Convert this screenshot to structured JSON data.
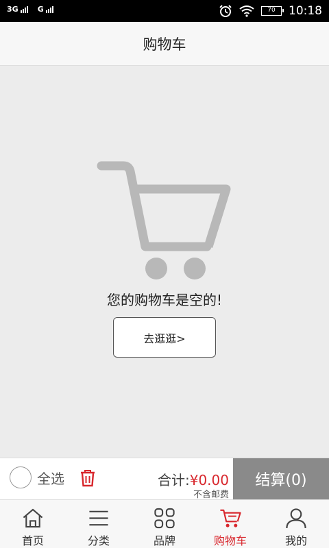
{
  "status_bar": {
    "sim1_label": "3G",
    "sim2_label": "G",
    "battery_level": "70",
    "time": "10:18"
  },
  "header": {
    "title": "购物车"
  },
  "empty_state": {
    "message": "您的购物车是空的!",
    "button_label": "去逛逛>"
  },
  "checkout": {
    "select_all_label": "全选",
    "total_label": "合计:",
    "total_value": "¥0.00",
    "shipping_note": "不含邮费",
    "checkout_label": "结算(0)"
  },
  "tabs": [
    {
      "label": "首页",
      "icon": "home-icon",
      "active": false
    },
    {
      "label": "分类",
      "icon": "list-icon",
      "active": false
    },
    {
      "label": "品牌",
      "icon": "grid-icon",
      "active": false
    },
    {
      "label": "购物车",
      "icon": "cart-icon",
      "active": true
    },
    {
      "label": "我的",
      "icon": "user-icon",
      "active": false
    }
  ],
  "colors": {
    "accent": "#d8262c",
    "checkout_button": "#8a8a8a",
    "cart_illustration": "#b8b8b8"
  }
}
